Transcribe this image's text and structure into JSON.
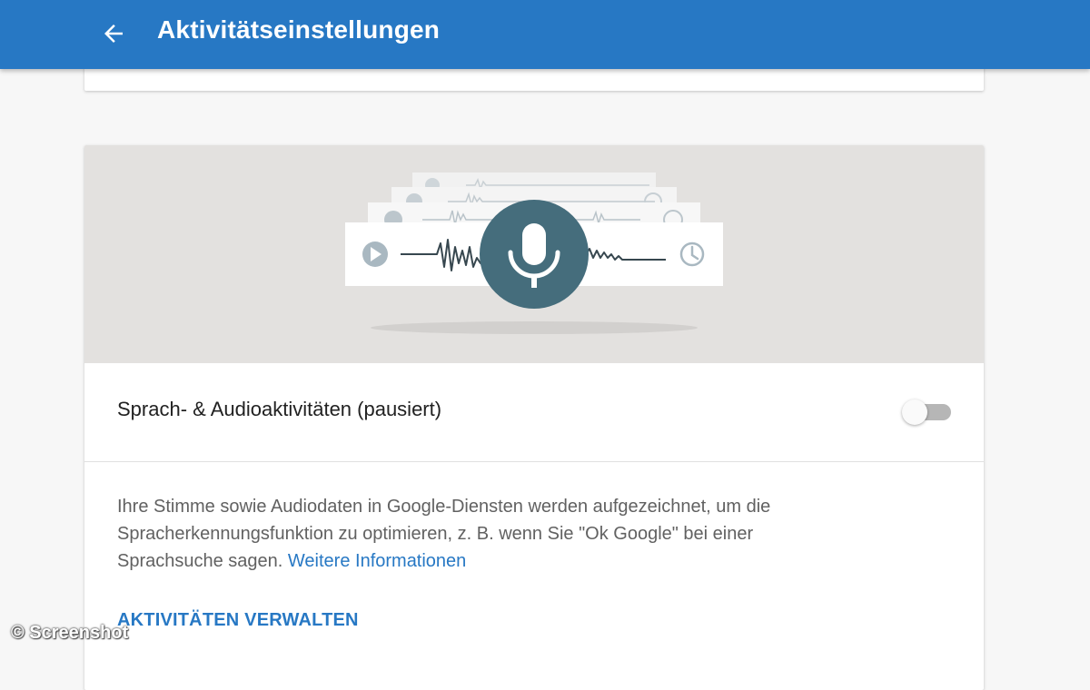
{
  "header": {
    "title": "Aktivitätseinstellungen",
    "back_icon": "arrow-back-icon",
    "background_color": "#2778c4"
  },
  "hero": {
    "illustration_icons": [
      "play-icon",
      "waveform",
      "microphone-icon",
      "clock-icon"
    ],
    "background_color": "#e3e1df",
    "mic_circle_color": "#456d7c"
  },
  "setting": {
    "label": "Sprach- & Audioaktivitäten (pausiert)",
    "toggle_state": "off"
  },
  "description": {
    "text": "Ihre Stimme sowie Audiodaten in Google-Diensten werden aufgezeichnet, um die Spracherkennungsfunktion zu optimieren, z. B. wenn Sie \"Ok Google\" bei einer Sprachsuche sagen.",
    "link_label": "Weitere Informationen"
  },
  "manage_link": "AKTIVITÄTEN VERWALTEN",
  "watermark": "© Screenshot",
  "colors": {
    "accent": "#2778c4",
    "text_primary": "#212121",
    "text_secondary": "#616161"
  }
}
